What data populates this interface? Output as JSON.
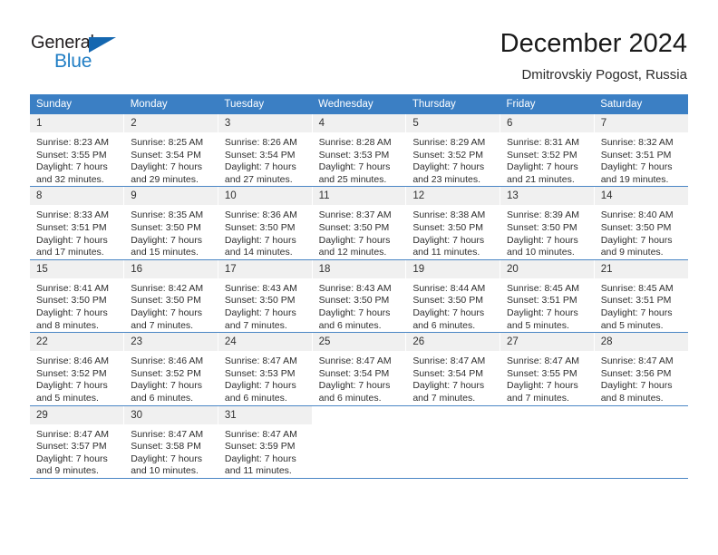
{
  "brand": {
    "name_part1": "General",
    "name_part2": "Blue",
    "triangle_icon": "triangle-icon",
    "accent_color": "#1f7dc4",
    "triangle_color": "#1567b0"
  },
  "header": {
    "title": "December 2024",
    "subtitle": "Dmitrovskiy Pogost, Russia"
  },
  "theme": {
    "header_row_color": "#3b7fc4",
    "daynum_bg": "#f0f0f0",
    "grid_line_color": "#4a86c5"
  },
  "weekday_headers": [
    "Sunday",
    "Monday",
    "Tuesday",
    "Wednesday",
    "Thursday",
    "Friday",
    "Saturday"
  ],
  "weeks": [
    {
      "days": [
        {
          "num": "1",
          "sunrise": "Sunrise: 8:23 AM",
          "sunset": "Sunset: 3:55 PM",
          "daylight_line1": "Daylight: 7 hours",
          "daylight_line2": "and 32 minutes."
        },
        {
          "num": "2",
          "sunrise": "Sunrise: 8:25 AM",
          "sunset": "Sunset: 3:54 PM",
          "daylight_line1": "Daylight: 7 hours",
          "daylight_line2": "and 29 minutes."
        },
        {
          "num": "3",
          "sunrise": "Sunrise: 8:26 AM",
          "sunset": "Sunset: 3:54 PM",
          "daylight_line1": "Daylight: 7 hours",
          "daylight_line2": "and 27 minutes."
        },
        {
          "num": "4",
          "sunrise": "Sunrise: 8:28 AM",
          "sunset": "Sunset: 3:53 PM",
          "daylight_line1": "Daylight: 7 hours",
          "daylight_line2": "and 25 minutes."
        },
        {
          "num": "5",
          "sunrise": "Sunrise: 8:29 AM",
          "sunset": "Sunset: 3:52 PM",
          "daylight_line1": "Daylight: 7 hours",
          "daylight_line2": "and 23 minutes."
        },
        {
          "num": "6",
          "sunrise": "Sunrise: 8:31 AM",
          "sunset": "Sunset: 3:52 PM",
          "daylight_line1": "Daylight: 7 hours",
          "daylight_line2": "and 21 minutes."
        },
        {
          "num": "7",
          "sunrise": "Sunrise: 8:32 AM",
          "sunset": "Sunset: 3:51 PM",
          "daylight_line1": "Daylight: 7 hours",
          "daylight_line2": "and 19 minutes."
        }
      ]
    },
    {
      "days": [
        {
          "num": "8",
          "sunrise": "Sunrise: 8:33 AM",
          "sunset": "Sunset: 3:51 PM",
          "daylight_line1": "Daylight: 7 hours",
          "daylight_line2": "and 17 minutes."
        },
        {
          "num": "9",
          "sunrise": "Sunrise: 8:35 AM",
          "sunset": "Sunset: 3:50 PM",
          "daylight_line1": "Daylight: 7 hours",
          "daylight_line2": "and 15 minutes."
        },
        {
          "num": "10",
          "sunrise": "Sunrise: 8:36 AM",
          "sunset": "Sunset: 3:50 PM",
          "daylight_line1": "Daylight: 7 hours",
          "daylight_line2": "and 14 minutes."
        },
        {
          "num": "11",
          "sunrise": "Sunrise: 8:37 AM",
          "sunset": "Sunset: 3:50 PM",
          "daylight_line1": "Daylight: 7 hours",
          "daylight_line2": "and 12 minutes."
        },
        {
          "num": "12",
          "sunrise": "Sunrise: 8:38 AM",
          "sunset": "Sunset: 3:50 PM",
          "daylight_line1": "Daylight: 7 hours",
          "daylight_line2": "and 11 minutes."
        },
        {
          "num": "13",
          "sunrise": "Sunrise: 8:39 AM",
          "sunset": "Sunset: 3:50 PM",
          "daylight_line1": "Daylight: 7 hours",
          "daylight_line2": "and 10 minutes."
        },
        {
          "num": "14",
          "sunrise": "Sunrise: 8:40 AM",
          "sunset": "Sunset: 3:50 PM",
          "daylight_line1": "Daylight: 7 hours",
          "daylight_line2": "and 9 minutes."
        }
      ]
    },
    {
      "days": [
        {
          "num": "15",
          "sunrise": "Sunrise: 8:41 AM",
          "sunset": "Sunset: 3:50 PM",
          "daylight_line1": "Daylight: 7 hours",
          "daylight_line2": "and 8 minutes."
        },
        {
          "num": "16",
          "sunrise": "Sunrise: 8:42 AM",
          "sunset": "Sunset: 3:50 PM",
          "daylight_line1": "Daylight: 7 hours",
          "daylight_line2": "and 7 minutes."
        },
        {
          "num": "17",
          "sunrise": "Sunrise: 8:43 AM",
          "sunset": "Sunset: 3:50 PM",
          "daylight_line1": "Daylight: 7 hours",
          "daylight_line2": "and 7 minutes."
        },
        {
          "num": "18",
          "sunrise": "Sunrise: 8:43 AM",
          "sunset": "Sunset: 3:50 PM",
          "daylight_line1": "Daylight: 7 hours",
          "daylight_line2": "and 6 minutes."
        },
        {
          "num": "19",
          "sunrise": "Sunrise: 8:44 AM",
          "sunset": "Sunset: 3:50 PM",
          "daylight_line1": "Daylight: 7 hours",
          "daylight_line2": "and 6 minutes."
        },
        {
          "num": "20",
          "sunrise": "Sunrise: 8:45 AM",
          "sunset": "Sunset: 3:51 PM",
          "daylight_line1": "Daylight: 7 hours",
          "daylight_line2": "and 5 minutes."
        },
        {
          "num": "21",
          "sunrise": "Sunrise: 8:45 AM",
          "sunset": "Sunset: 3:51 PM",
          "daylight_line1": "Daylight: 7 hours",
          "daylight_line2": "and 5 minutes."
        }
      ]
    },
    {
      "days": [
        {
          "num": "22",
          "sunrise": "Sunrise: 8:46 AM",
          "sunset": "Sunset: 3:52 PM",
          "daylight_line1": "Daylight: 7 hours",
          "daylight_line2": "and 5 minutes."
        },
        {
          "num": "23",
          "sunrise": "Sunrise: 8:46 AM",
          "sunset": "Sunset: 3:52 PM",
          "daylight_line1": "Daylight: 7 hours",
          "daylight_line2": "and 6 minutes."
        },
        {
          "num": "24",
          "sunrise": "Sunrise: 8:47 AM",
          "sunset": "Sunset: 3:53 PM",
          "daylight_line1": "Daylight: 7 hours",
          "daylight_line2": "and 6 minutes."
        },
        {
          "num": "25",
          "sunrise": "Sunrise: 8:47 AM",
          "sunset": "Sunset: 3:54 PM",
          "daylight_line1": "Daylight: 7 hours",
          "daylight_line2": "and 6 minutes."
        },
        {
          "num": "26",
          "sunrise": "Sunrise: 8:47 AM",
          "sunset": "Sunset: 3:54 PM",
          "daylight_line1": "Daylight: 7 hours",
          "daylight_line2": "and 7 minutes."
        },
        {
          "num": "27",
          "sunrise": "Sunrise: 8:47 AM",
          "sunset": "Sunset: 3:55 PM",
          "daylight_line1": "Daylight: 7 hours",
          "daylight_line2": "and 7 minutes."
        },
        {
          "num": "28",
          "sunrise": "Sunrise: 8:47 AM",
          "sunset": "Sunset: 3:56 PM",
          "daylight_line1": "Daylight: 7 hours",
          "daylight_line2": "and 8 minutes."
        }
      ]
    },
    {
      "days": [
        {
          "num": "29",
          "sunrise": "Sunrise: 8:47 AM",
          "sunset": "Sunset: 3:57 PM",
          "daylight_line1": "Daylight: 7 hours",
          "daylight_line2": "and 9 minutes."
        },
        {
          "num": "30",
          "sunrise": "Sunrise: 8:47 AM",
          "sunset": "Sunset: 3:58 PM",
          "daylight_line1": "Daylight: 7 hours",
          "daylight_line2": "and 10 minutes."
        },
        {
          "num": "31",
          "sunrise": "Sunrise: 8:47 AM",
          "sunset": "Sunset: 3:59 PM",
          "daylight_line1": "Daylight: 7 hours",
          "daylight_line2": "and 11 minutes."
        },
        {
          "num": "",
          "sunrise": "",
          "sunset": "",
          "daylight_line1": "",
          "daylight_line2": ""
        },
        {
          "num": "",
          "sunrise": "",
          "sunset": "",
          "daylight_line1": "",
          "daylight_line2": ""
        },
        {
          "num": "",
          "sunrise": "",
          "sunset": "",
          "daylight_line1": "",
          "daylight_line2": ""
        },
        {
          "num": "",
          "sunrise": "",
          "sunset": "",
          "daylight_line1": "",
          "daylight_line2": ""
        }
      ]
    }
  ]
}
